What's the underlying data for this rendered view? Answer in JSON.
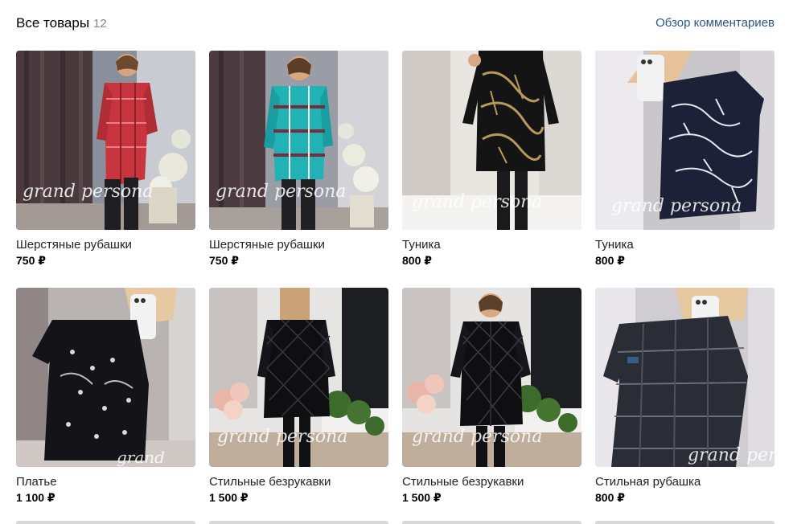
{
  "header": {
    "title": "Все товары",
    "count": "12",
    "review_link": "Обзор комментариев"
  },
  "products": [
    {
      "title": "Шерстяные рубашки",
      "price": "750 ₽",
      "image_caption": "grand persona"
    },
    {
      "title": "Шерстяные рубашки",
      "price": "750 ₽",
      "image_caption": "grand persona"
    },
    {
      "title": "Туника",
      "price": "800 ₽",
      "image_caption": "grand persona"
    },
    {
      "title": "Туника",
      "price": "800 ₽",
      "image_caption": "grand persona"
    },
    {
      "title": "Платье",
      "price": "1 100 ₽",
      "image_caption": "grand"
    },
    {
      "title": "Стильные безрукавки",
      "price": "1 500 ₽",
      "image_caption": "grand persona"
    },
    {
      "title": "Стильные безрукавки",
      "price": "1 500 ₽",
      "image_caption": "grand persona"
    },
    {
      "title": "Стильная рубашка",
      "price": "800 ₽",
      "image_caption": "grand persona"
    }
  ],
  "colors": {
    "link": "#2a5885",
    "count": "#828282",
    "text": "#222222"
  }
}
